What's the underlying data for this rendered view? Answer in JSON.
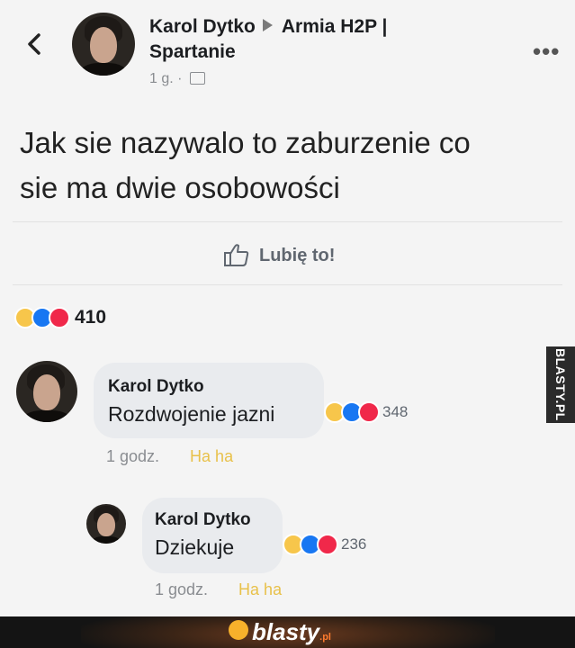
{
  "header": {
    "author": "Karol Dytko",
    "group_line1": "Armia H2P |",
    "group_line2": "Spartanie",
    "time": "1 g. ·"
  },
  "post": {
    "text_line1": "Jak sie nazywalo to zaburzenie co",
    "text_line2": "sie ma dwie osobowości",
    "like_label": "Lubię to!",
    "reaction_count": "410"
  },
  "comments": [
    {
      "author": "Karol Dytko",
      "text": "Rozdwojenie jazni",
      "reaction_count": "348",
      "time": "1 godz.",
      "action": "Ha ha"
    },
    {
      "author": "Karol Dytko",
      "text": "Dziekuje",
      "reaction_count": "236",
      "time": "1 godz.",
      "action": "Ha ha"
    }
  ],
  "watermark": "BLASTY.PL",
  "footer": {
    "brand": "blasty",
    "tld": ".pl"
  },
  "colors": {
    "like": "#1877f2",
    "love": "#f0284a",
    "haha": "#f7c64b",
    "muted": "#8a8d91"
  }
}
